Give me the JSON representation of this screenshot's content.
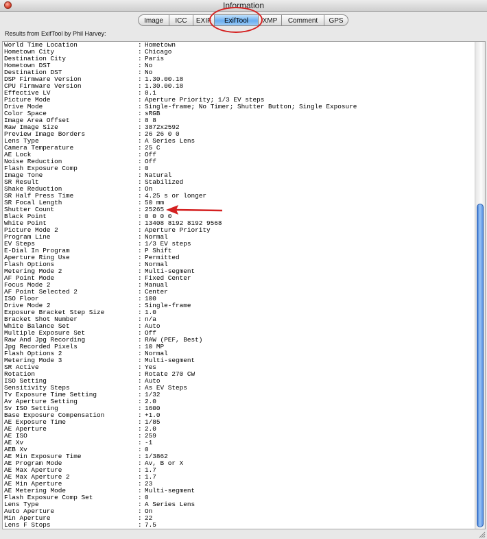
{
  "window": {
    "title": "Information"
  },
  "tabs": [
    {
      "label": "Image",
      "selected": false
    },
    {
      "label": "ICC",
      "selected": false
    },
    {
      "label": "EXIF",
      "selected": false
    },
    {
      "label": "ExifTool",
      "selected": true
    },
    {
      "label": "XMP",
      "selected": false
    },
    {
      "label": "Comment",
      "selected": false
    },
    {
      "label": "GPS",
      "selected": false
    }
  ],
  "results_label": "Results from ExifTool by Phil Harvey:",
  "highlight_color": "#d42020",
  "selected_tab_color": "#6aaef0",
  "separator": ":",
  "rows": [
    {
      "key": "World Time Location",
      "value": "Hometown"
    },
    {
      "key": "Hometown City",
      "value": "Chicago"
    },
    {
      "key": "Destination City",
      "value": "Paris"
    },
    {
      "key": "Hometown DST",
      "value": "No"
    },
    {
      "key": "Destination DST",
      "value": "No"
    },
    {
      "key": "DSP Firmware Version",
      "value": "1.30.00.18"
    },
    {
      "key": "CPU Firmware Version",
      "value": "1.30.00.18"
    },
    {
      "key": "Effective LV",
      "value": "8.1"
    },
    {
      "key": "Picture Mode",
      "value": "Aperture Priority; 1/3 EV steps"
    },
    {
      "key": "Drive Mode",
      "value": "Single-frame; No Timer; Shutter Button; Single Exposure"
    },
    {
      "key": "Color Space",
      "value": "sRGB"
    },
    {
      "key": "Image Area Offset",
      "value": "8 8"
    },
    {
      "key": "Raw Image Size",
      "value": "3872x2592"
    },
    {
      "key": "Preview Image Borders",
      "value": "26 26 0 0"
    },
    {
      "key": "Lens Type",
      "value": "A Series Lens"
    },
    {
      "key": "Camera Temperature",
      "value": "25 C"
    },
    {
      "key": "AE Lock",
      "value": "Off"
    },
    {
      "key": "Noise Reduction",
      "value": "Off"
    },
    {
      "key": "Flash Exposure Comp",
      "value": "0"
    },
    {
      "key": "Image Tone",
      "value": "Natural"
    },
    {
      "key": "SR Result",
      "value": "Stabilized"
    },
    {
      "key": "Shake Reduction",
      "value": "On"
    },
    {
      "key": "SR Half Press Time",
      "value": "4.25 s or longer"
    },
    {
      "key": "SR Focal Length",
      "value": "50 mm"
    },
    {
      "key": "Shutter Count",
      "value": "25265"
    },
    {
      "key": "Black Point",
      "value": "0 0 0 0"
    },
    {
      "key": "White Point",
      "value": "13408 8192 8192 9568"
    },
    {
      "key": "Picture Mode 2",
      "value": "Aperture Priority"
    },
    {
      "key": "Program Line",
      "value": "Normal"
    },
    {
      "key": "EV Steps",
      "value": "1/3 EV steps"
    },
    {
      "key": "E-Dial In Program",
      "value": "P Shift"
    },
    {
      "key": "Aperture Ring Use",
      "value": "Permitted"
    },
    {
      "key": "Flash Options",
      "value": "Normal"
    },
    {
      "key": "Metering Mode 2",
      "value": "Multi-segment"
    },
    {
      "key": "AF Point Mode",
      "value": "Fixed Center"
    },
    {
      "key": "Focus Mode 2",
      "value": "Manual"
    },
    {
      "key": "AF Point Selected 2",
      "value": "Center"
    },
    {
      "key": "ISO Floor",
      "value": "100"
    },
    {
      "key": "Drive Mode 2",
      "value": "Single-frame"
    },
    {
      "key": "Exposure Bracket Step Size",
      "value": "1.0"
    },
    {
      "key": "Bracket Shot Number",
      "value": "n/a"
    },
    {
      "key": "White Balance Set",
      "value": "Auto"
    },
    {
      "key": "Multiple Exposure Set",
      "value": "Off"
    },
    {
      "key": "Raw And Jpg Recording",
      "value": "RAW (PEF, Best)"
    },
    {
      "key": "Jpg Recorded Pixels",
      "value": "10 MP"
    },
    {
      "key": "Flash Options 2",
      "value": "Normal"
    },
    {
      "key": "Metering Mode 3",
      "value": "Multi-segment"
    },
    {
      "key": "SR Active",
      "value": "Yes"
    },
    {
      "key": "Rotation",
      "value": "Rotate 270 CW"
    },
    {
      "key": "ISO Setting",
      "value": "Auto"
    },
    {
      "key": "Sensitivity Steps",
      "value": "As EV Steps"
    },
    {
      "key": "Tv Exposure Time Setting",
      "value": "1/32"
    },
    {
      "key": "Av Aperture Setting",
      "value": "2.0"
    },
    {
      "key": "Sv ISO Setting",
      "value": "1600"
    },
    {
      "key": "Base Exposure Compensation",
      "value": "+1.0"
    },
    {
      "key": "AE Exposure Time",
      "value": "1/85"
    },
    {
      "key": "AE Aperture",
      "value": "2.0"
    },
    {
      "key": "AE ISO",
      "value": "259"
    },
    {
      "key": "AE Xv",
      "value": "-1"
    },
    {
      "key": "AEB Xv",
      "value": "0"
    },
    {
      "key": "AE Min Exposure Time",
      "value": "1/3862"
    },
    {
      "key": "AE Program Mode",
      "value": "Av, B or X"
    },
    {
      "key": "AE Max Aperture",
      "value": "1.7"
    },
    {
      "key": "AE Max Aperture 2",
      "value": "1.7"
    },
    {
      "key": "AE Min Aperture",
      "value": "23"
    },
    {
      "key": "AE Metering Mode",
      "value": "Multi-segment"
    },
    {
      "key": "Flash Exposure Comp Set",
      "value": "0"
    },
    {
      "key": "Lens Type",
      "value": "A Series Lens"
    },
    {
      "key": "Auto Aperture",
      "value": "On"
    },
    {
      "key": "Min Aperture",
      "value": "22"
    },
    {
      "key": "Lens F Stops",
      "value": "7.5"
    }
  ]
}
